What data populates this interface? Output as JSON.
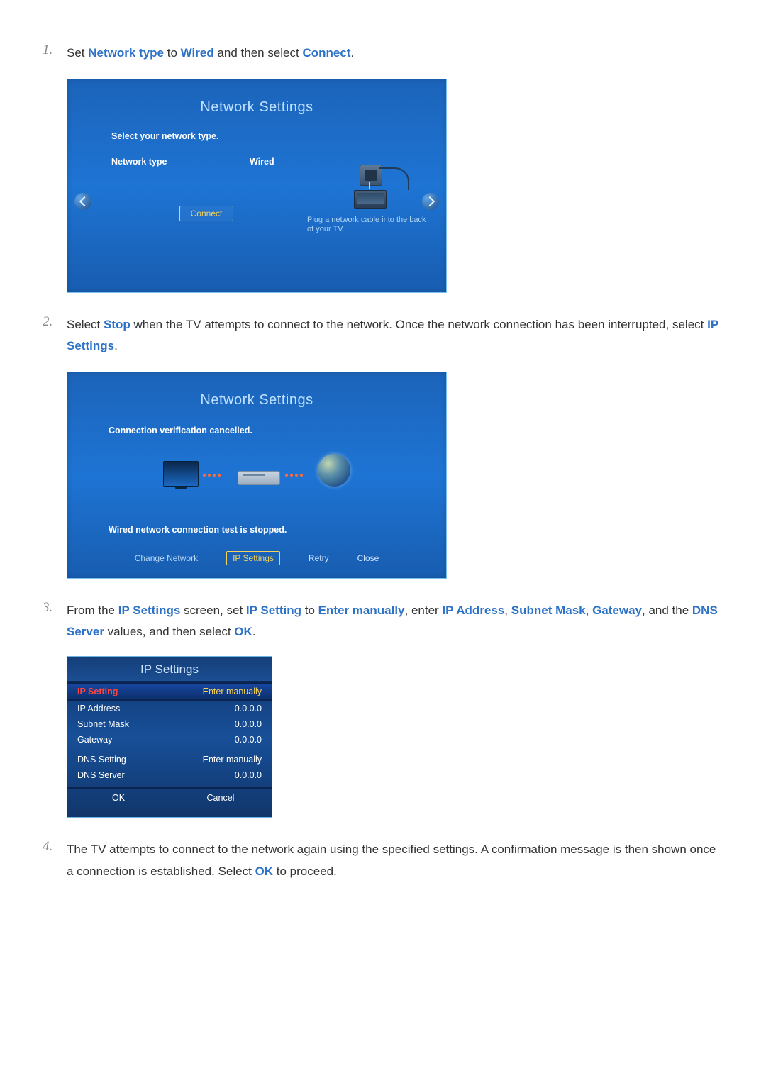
{
  "step1": {
    "text_parts": [
      "Set ",
      "Network type",
      " to ",
      "Wired",
      " and then select ",
      "Connect",
      "."
    ]
  },
  "step2": {
    "text_parts": [
      "Select ",
      "Stop",
      " when the TV attempts to connect to the network. Once the network connection has been interrupted, select ",
      "IP Settings",
      "."
    ]
  },
  "step3": {
    "text_parts": [
      "From the ",
      "IP Settings",
      " screen, set ",
      "IP Setting",
      " to ",
      "Enter manually",
      ", enter ",
      "IP Address",
      ", ",
      "Subnet Mask",
      ", ",
      "Gateway",
      ", and the ",
      "DNS Server",
      " values, and then select ",
      "OK",
      "."
    ]
  },
  "step4": {
    "text_parts": [
      "The TV attempts to connect to the network again using the specified settings. A confirmation message is then shown once a connection is established. Select ",
      "OK",
      " to proceed."
    ]
  },
  "step_numbers": {
    "n1": "1.",
    "n2": "2.",
    "n3": "3.",
    "n4": "4."
  },
  "panel1": {
    "title": "Network Settings",
    "select_type": "Select your network type.",
    "network_type_label": "Network type",
    "network_type_value": "Wired",
    "connect": "Connect",
    "plug_hint": "Plug a network cable into the back of your TV."
  },
  "panel2": {
    "title": "Network Settings",
    "cancelled": "Connection verification cancelled.",
    "stopped": "Wired network connection test is stopped.",
    "buttons": {
      "change": "Change Network",
      "ip": "IP Settings",
      "retry": "Retry",
      "close": "Close"
    }
  },
  "panel3": {
    "title": "IP Settings",
    "rows": {
      "ip_setting_label": "IP Setting",
      "ip_setting_value": "Enter manually",
      "ip_address_label": "IP Address",
      "ip_address_value": "0.0.0.0",
      "subnet_label": "Subnet Mask",
      "subnet_value": "0.0.0.0",
      "gateway_label": "Gateway",
      "gateway_value": "0.0.0.0",
      "dns_setting_label": "DNS Setting",
      "dns_setting_value": "Enter manually",
      "dns_server_label": "DNS Server",
      "dns_server_value": "0.0.0.0"
    },
    "ok": "OK",
    "cancel": "Cancel"
  }
}
